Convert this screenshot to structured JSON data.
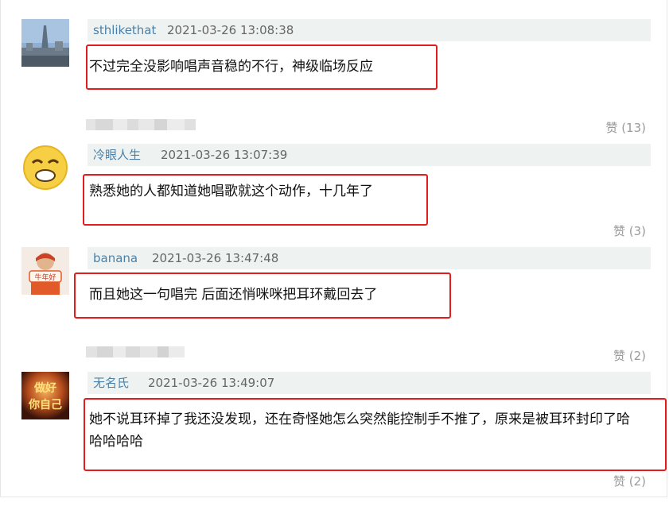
{
  "comments": [
    {
      "user": "sthlikethat",
      "date": "2021-03-26 13:08:38",
      "text": "不过完全没影响唱声音稳的不行，神级临场反应",
      "likes": "赞 (13)"
    },
    {
      "user": "冷眼人生",
      "date": "2021-03-26 13:07:39",
      "text": "熟悉她的人都知道她唱歌就这个动作，十几年了",
      "likes": "赞 (3)"
    },
    {
      "user": "banana",
      "date": "2021-03-26 13:47:48",
      "text": "而且她这一句唱完 后面还悄咪咪把耳环戴回去了",
      "likes": "赞 (2)"
    },
    {
      "user": "无名氏",
      "date": "2021-03-26 13:49:07",
      "text_line1": "她不说耳环掉了我还没发现，还在奇怪她怎么突然能控制手不推了，原来是被耳环封印了哈",
      "text_line2": "哈哈哈哈",
      "likes": "赞 (2)"
    }
  ],
  "avatar_badges": {
    "banana": "牛年好",
    "wuming_line1": "做好",
    "wuming_line2": "你自己"
  },
  "colors": {
    "accent_red": "#e21d1d",
    "username": "#4b80a8",
    "meta_bg": "#eef3f2"
  }
}
